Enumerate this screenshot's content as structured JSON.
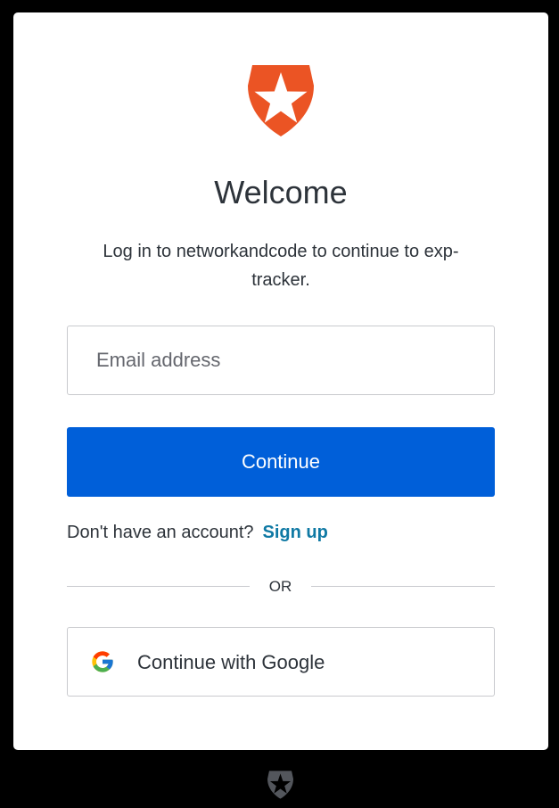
{
  "colors": {
    "background": "#000000",
    "card": "#ffffff",
    "brand_orange": "#eb5424",
    "primary_button": "#005fd9",
    "link": "#0f79a4",
    "text": "#2d333a",
    "border": "#c9cace",
    "footer_icon": "#53565c"
  },
  "logo": {
    "icon": "auth0-shield-star-icon"
  },
  "title": "Welcome",
  "description": "Log in to networkandcode to continue to exp-tracker.",
  "email": {
    "placeholder": "Email address",
    "value": ""
  },
  "continue_label": "Continue",
  "signup": {
    "prompt": "Don't have an account?",
    "link_label": "Sign up"
  },
  "divider_label": "OR",
  "google": {
    "label": "Continue with Google",
    "icon": "google-g-icon"
  },
  "footer": {
    "icon": "auth0-shield-star-icon"
  }
}
